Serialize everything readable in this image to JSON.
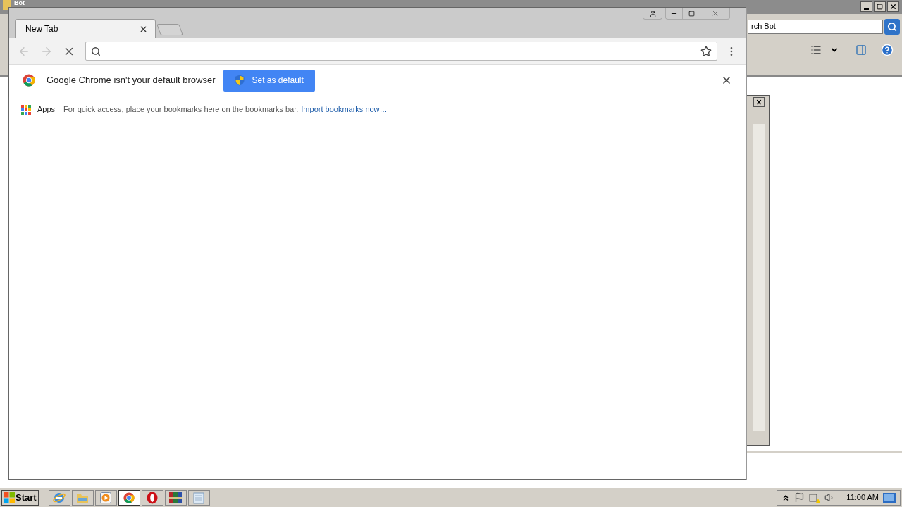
{
  "background_window": {
    "title": "Bot",
    "search": {
      "value": "rch Bot"
    }
  },
  "browser": {
    "tabs": [
      {
        "label": "New Tab",
        "selected": true
      }
    ],
    "nav": {
      "back": {
        "disabled": true
      },
      "forward": {
        "disabled": true
      }
    },
    "infobar": {
      "message": "Google Chrome isn't your default browser",
      "button": "Set as default"
    },
    "bookmarks_bar": {
      "apps": "Apps",
      "hint": "For quick access, place your bookmarks here on the bookmarks bar.",
      "link": "Import bookmarks now…"
    }
  },
  "taskbar": {
    "start": "Start",
    "apps": [
      {
        "kind": "ie",
        "selected": false
      },
      {
        "kind": "explorer",
        "selected": false
      },
      {
        "kind": "media",
        "selected": false
      },
      {
        "kind": "chrome",
        "selected": true
      },
      {
        "kind": "opera",
        "selected": false
      },
      {
        "kind": "archive",
        "selected": false
      },
      {
        "kind": "notepad",
        "selected": false
      }
    ],
    "clock": "11:00 AM"
  }
}
